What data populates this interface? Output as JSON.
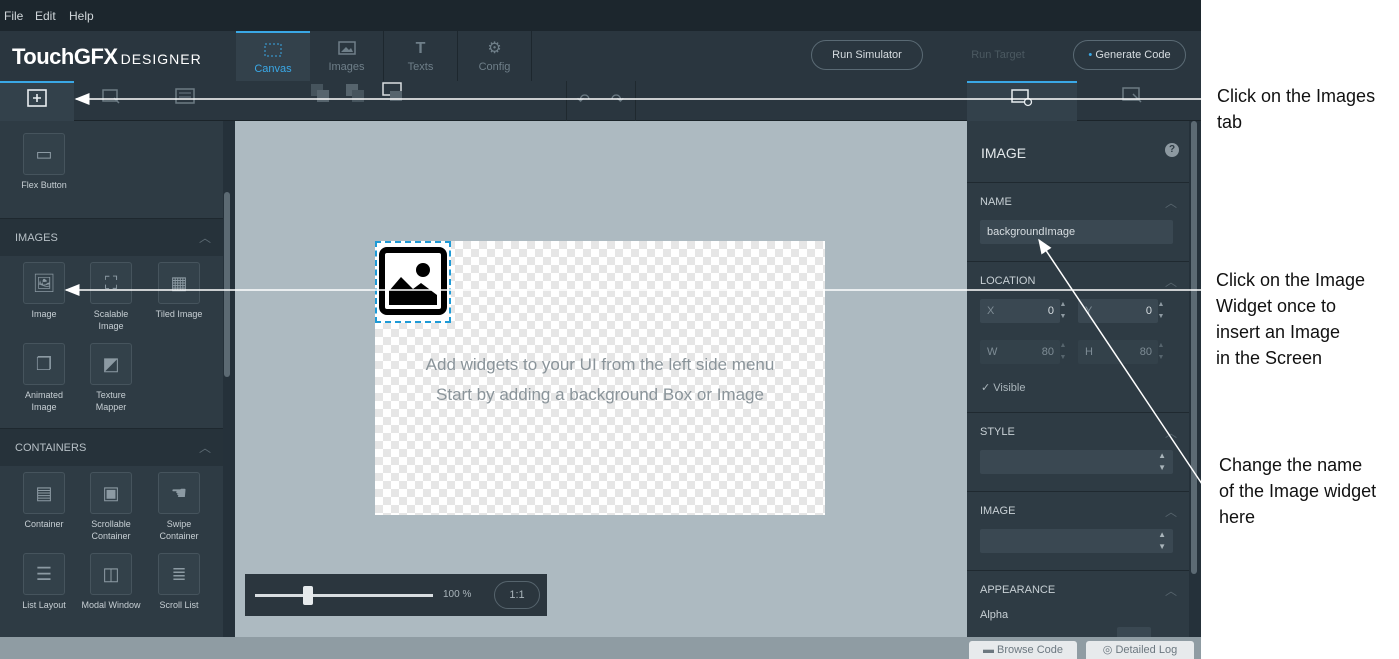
{
  "menu": {
    "file": "File",
    "edit": "Edit",
    "help": "Help"
  },
  "logo": {
    "brand": "TouchGFX",
    "suffix": "DESIGNER"
  },
  "nav_tabs": [
    {
      "label": "Canvas",
      "icon": "canvas-icon",
      "active": true
    },
    {
      "label": "Images",
      "icon": "image-icon",
      "active": false
    },
    {
      "label": "Texts",
      "icon": "text-icon",
      "active": false
    },
    {
      "label": "Config",
      "icon": "config-icon",
      "active": false
    }
  ],
  "toolbar": {
    "run_simulator": "Run Simulator",
    "run_target": "Run Target",
    "generate_code": "Generate Code"
  },
  "left_panel": {
    "flex_button": "Flex Button",
    "images_section": {
      "title": "IMAGES",
      "items": [
        "Image",
        "Scalable Image",
        "Tiled Image",
        "Animated Image",
        "Texture Mapper"
      ]
    },
    "containers_section": {
      "title": "CONTAINERS",
      "items": [
        "Container",
        "Scrollable Container",
        "Swipe Container",
        "List Layout",
        "Modal Window",
        "Scroll List"
      ]
    }
  },
  "canvas": {
    "hint_line1": "Add widgets to your UI from the left side menu",
    "hint_line2": "Start by adding a background Box or Image"
  },
  "zoom": {
    "value": "100 %",
    "reset": "1:1",
    "level": 0.3
  },
  "properties": {
    "header": "IMAGE",
    "name_section": "NAME",
    "name_value": "backgroundImage",
    "location_section": "LOCATION",
    "x_label": "X",
    "x_value": "0",
    "y_label": "Y",
    "y_value": "0",
    "w_label": "W",
    "w_value": "80",
    "h_label": "H",
    "h_value": "80",
    "visible": "Visible",
    "style_section": "STYLE",
    "image_section": "IMAGE",
    "appearance_section": "APPEARANCE",
    "alpha_label": "Alpha"
  },
  "status": {
    "browse_code": "Browse Code",
    "detailed_log": "Detailed Log"
  },
  "annotations": {
    "note1_line1": "Click on the Images",
    "note1_line2": "tab",
    "note2_line1": "Click on the Image",
    "note2_line2": "Widget once to",
    "note2_line3": "insert an Image",
    "note2_line4": "in the Screen",
    "note3_line1": "Change the name",
    "note3_line2": "of the Image widget",
    "note3_line3": "here"
  },
  "colors": {
    "accent": "#3aa8e6",
    "selection": "#1e9ad6",
    "panel": "#2e3b44"
  }
}
